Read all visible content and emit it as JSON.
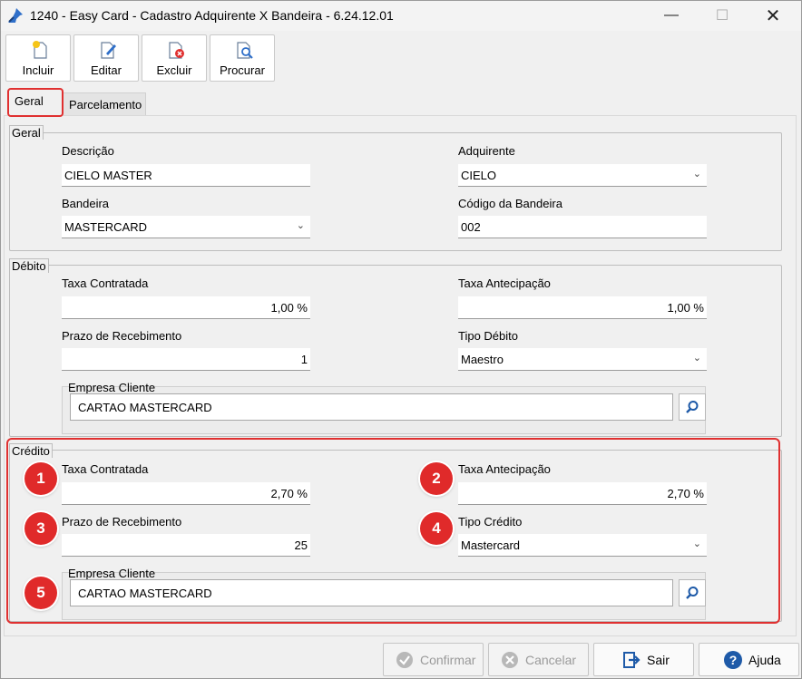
{
  "window": {
    "title": "1240 - Easy Card - Cadastro Adquirente X Bandeira - 6.24.12.01",
    "minimize": "—",
    "maximize": "☐",
    "close": "✕"
  },
  "toolbar": {
    "incluir": "Incluir",
    "editar": "Editar",
    "excluir": "Excluir",
    "procurar": "Procurar"
  },
  "tabs": [
    {
      "label": "Geral",
      "active": true
    },
    {
      "label": "Parcelamento",
      "active": false
    }
  ],
  "geral": {
    "legend": "Geral",
    "descricao_label": "Descrição",
    "descricao_value": "CIELO MASTER",
    "adquirente_label": "Adquirente",
    "adquirente_value": "CIELO",
    "bandeira_label": "Bandeira",
    "bandeira_value": "MASTERCARD",
    "codigo_label": "Código da Bandeira",
    "codigo_value": "002"
  },
  "debito": {
    "legend": "Débito",
    "taxa_contratada_label": "Taxa Contratada",
    "taxa_contratada_value": "1,00 %",
    "taxa_antecipacao_label": "Taxa Antecipação",
    "taxa_antecipacao_value": "1,00 %",
    "prazo_label": "Prazo de Recebimento",
    "prazo_value": "1",
    "tipo_label": "Tipo Débito",
    "tipo_value": "Maestro",
    "empresa_label": "Empresa Cliente",
    "empresa_value": "CARTAO MASTERCARD"
  },
  "credito": {
    "legend": "Crédito",
    "taxa_contratada_label": "Taxa Contratada",
    "taxa_contratada_value": "2,70 %",
    "taxa_antecipacao_label": "Taxa Antecipação",
    "taxa_antecipacao_value": "2,70 %",
    "prazo_label": "Prazo de Recebimento",
    "prazo_value": "25",
    "tipo_label": "Tipo Crédito",
    "tipo_value": "Mastercard",
    "empresa_label": "Empresa Cliente",
    "empresa_value": "CARTAO MASTERCARD"
  },
  "markers": [
    "1",
    "2",
    "3",
    "4",
    "5"
  ],
  "footer": {
    "confirmar": "Confirmar",
    "cancelar": "Cancelar",
    "sair": "Sair",
    "ajuda": "Ajuda"
  },
  "colors": {
    "highlight": "#e03030",
    "marker": "#e02a2a",
    "icon_blue": "#1e5aa8"
  }
}
